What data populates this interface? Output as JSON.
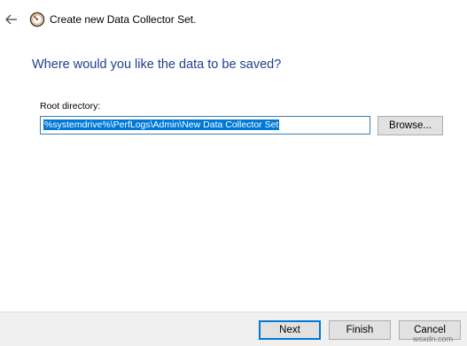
{
  "window": {
    "title": "Create new Data Collector Set.",
    "back_icon": "back-arrow-icon",
    "app_icon": "performance-monitor-gauge-icon"
  },
  "page": {
    "heading": "Where would you like the data to be saved?"
  },
  "root_directory": {
    "label": "Root directory:",
    "value": "%systemdrive%\\PerfLogs\\Admin\\New Data Collector Set",
    "browse_label": "Browse..."
  },
  "footer": {
    "next_label": "Next",
    "finish_label": "Finish",
    "cancel_label": "Cancel"
  },
  "watermark": "wsxdn.com",
  "colors": {
    "heading": "#1f3f8f",
    "selection": "#0078d7",
    "input_border": "#3c7fb1",
    "default_button_border": "#0078d7"
  }
}
